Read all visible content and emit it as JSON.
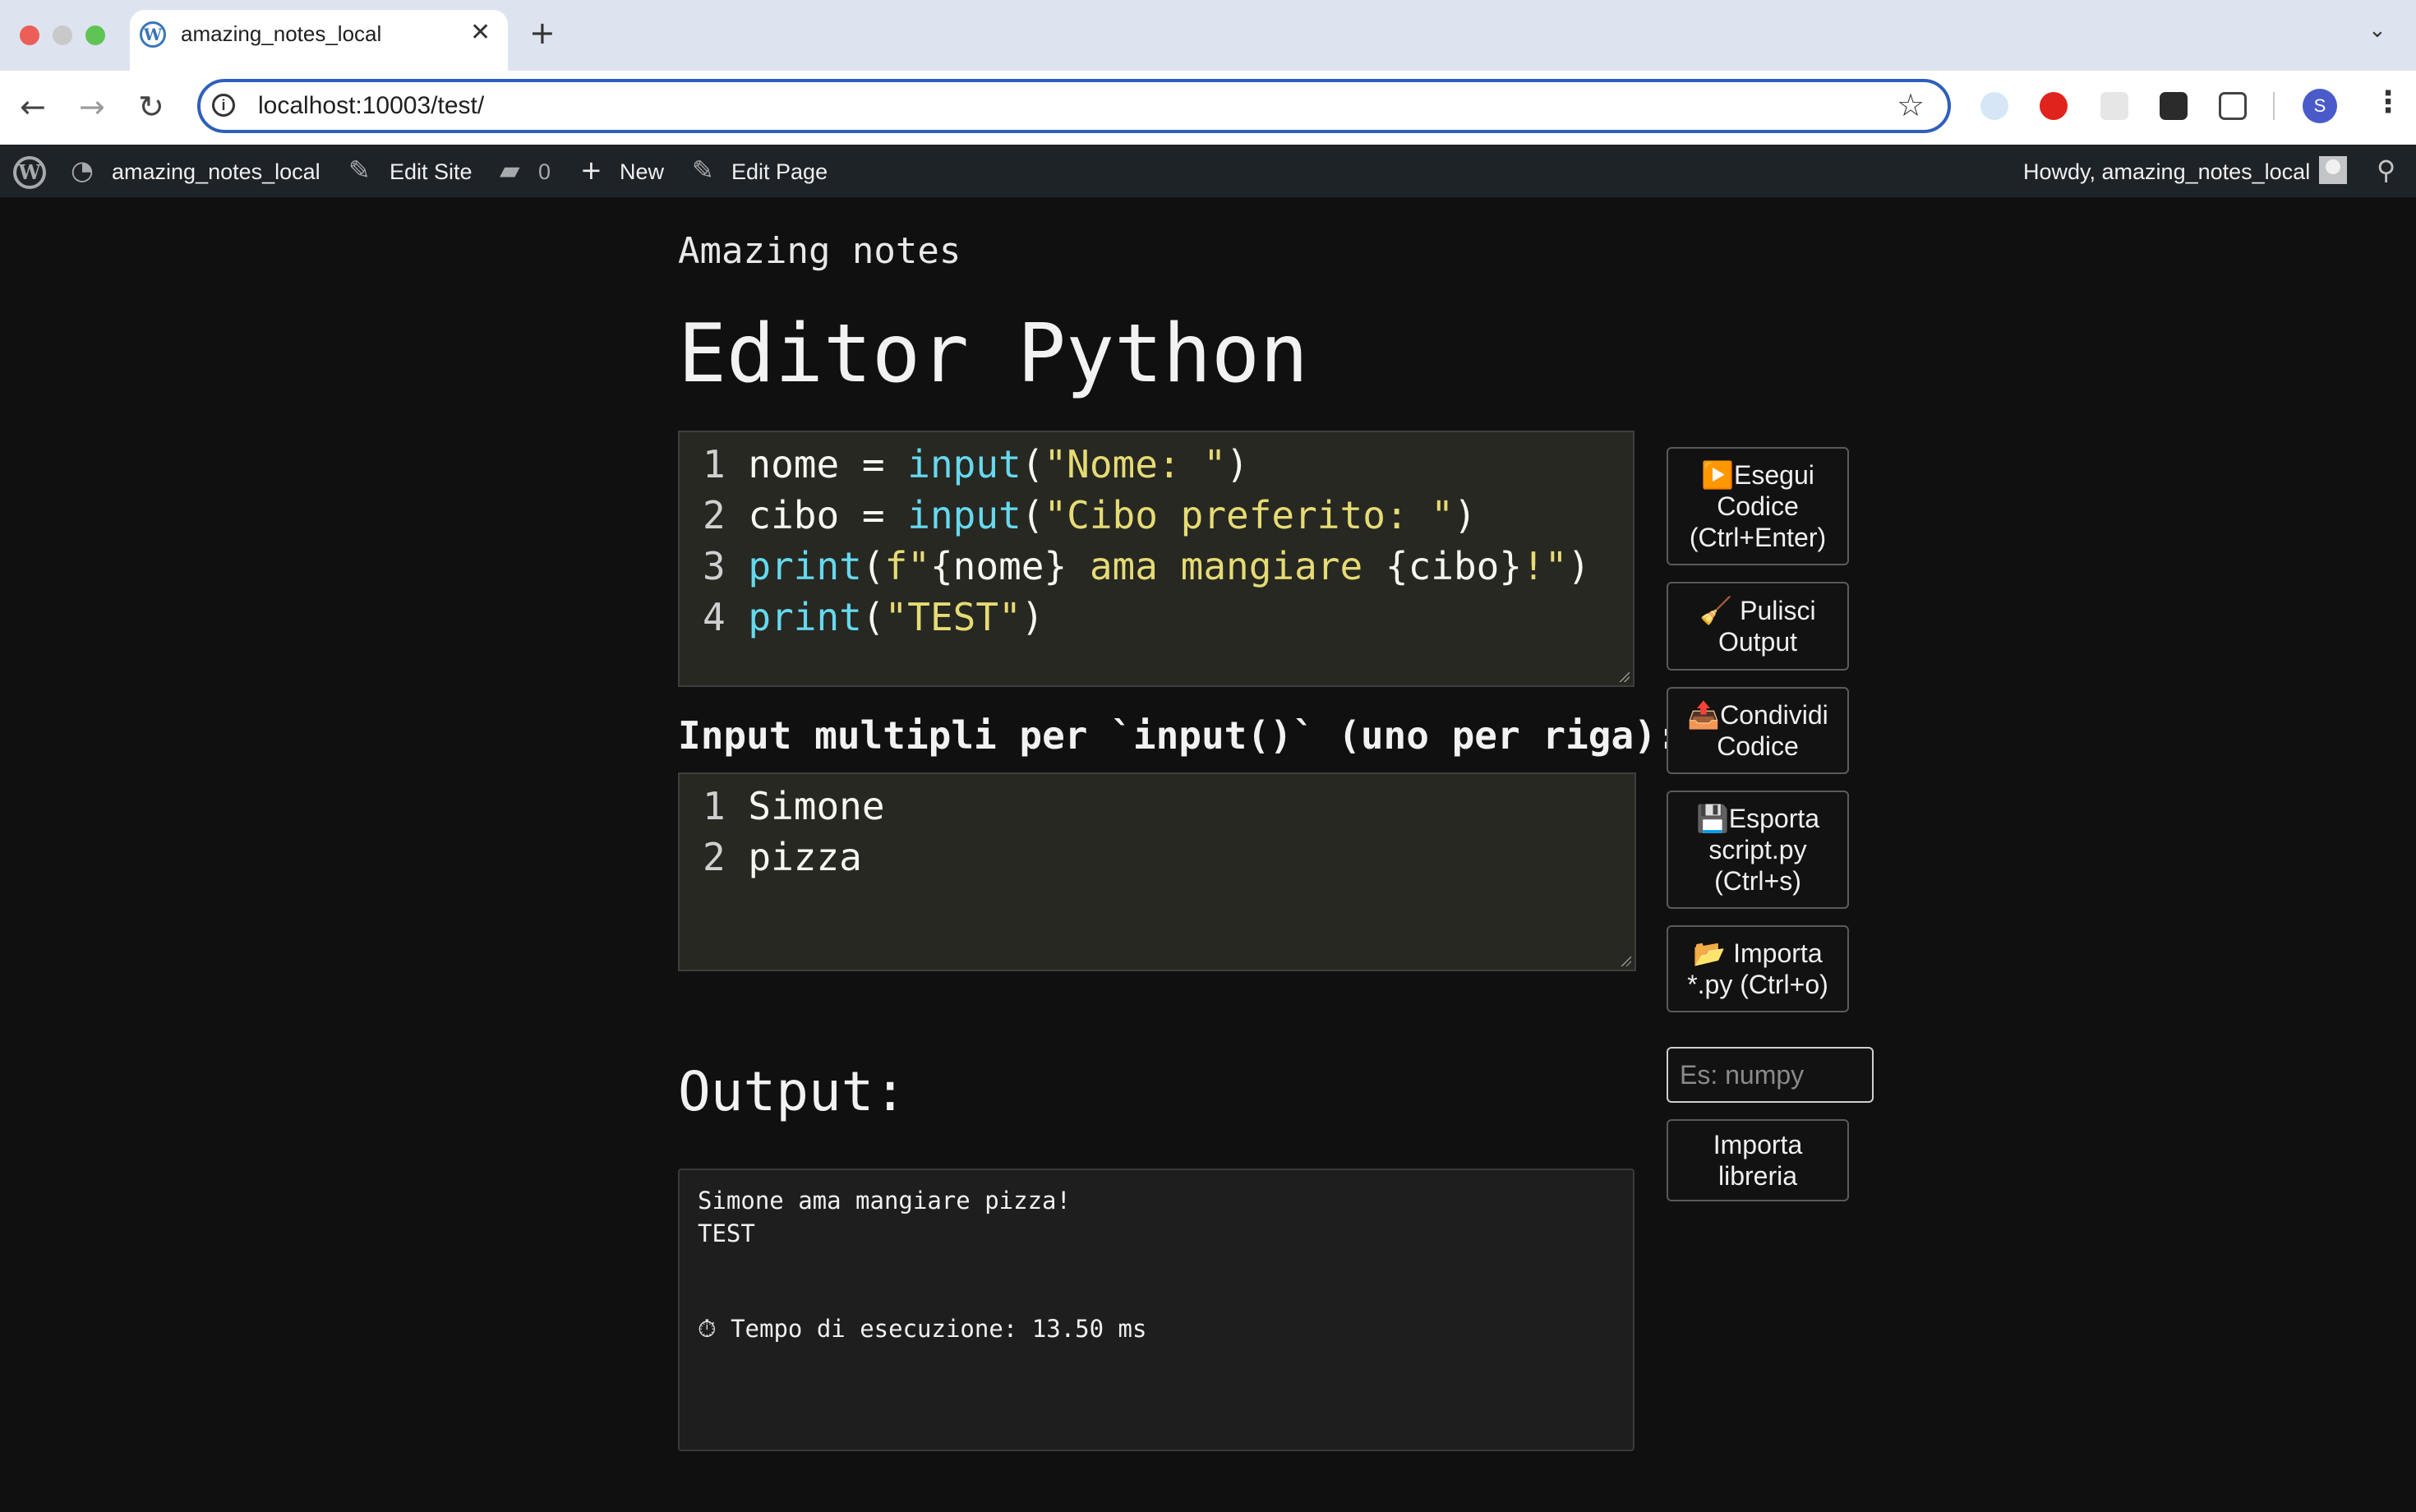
{
  "browser": {
    "tab_title": "amazing_notes_local",
    "url": "localhost:10003/test/",
    "profile_initial": "S"
  },
  "adminbar": {
    "site_name": "amazing_notes_local",
    "edit_site": "Edit Site",
    "comments_count": "0",
    "new": "New",
    "edit_page": "Edit Page",
    "howdy": "Howdy, amazing_notes_local"
  },
  "page": {
    "site_title": "Amazing notes",
    "title": "Editor Python"
  },
  "code_editor": {
    "lines": [
      {
        "num": "1",
        "text": "nome = input(\"Nome: \")"
      },
      {
        "num": "2",
        "text": "cibo = input(\"Cibo preferito: \")"
      },
      {
        "num": "3",
        "text": "print(f\"{nome} ama mangiare {cibo}!\")"
      },
      {
        "num": "4",
        "text": "print(\"TEST\")"
      }
    ]
  },
  "inputs": {
    "label": "Input multipli per `input()` (uno per riga):",
    "lines": [
      {
        "num": "1",
        "text": "Simone"
      },
      {
        "num": "2",
        "text": "pizza"
      }
    ]
  },
  "output": {
    "title": "Output:",
    "lines": [
      "Simone ama mangiare pizza!",
      "TEST"
    ],
    "timing": "⏱ Tempo di esecuzione: 13.50 ms"
  },
  "side_buttons": {
    "run": [
      "▶️Esegui",
      "Codice",
      "(Ctrl+Enter)"
    ],
    "clear": [
      "🧹 Pulisci",
      "Output"
    ],
    "share": [
      "📤Condividi",
      "Codice"
    ],
    "export": [
      "💾Esporta",
      "script.py",
      "(Ctrl+s)"
    ],
    "import": [
      "📂 Importa",
      "*.py (Ctrl+o)"
    ],
    "library_placeholder": "Es: numpy",
    "import_library": [
      "Importa",
      "libreria"
    ]
  },
  "colors": {
    "background": "#101010",
    "editor_bg": "#272822",
    "keyword_fn": "#66d9ef",
    "string": "#e6db74",
    "admin_bar": "#1d2327"
  }
}
